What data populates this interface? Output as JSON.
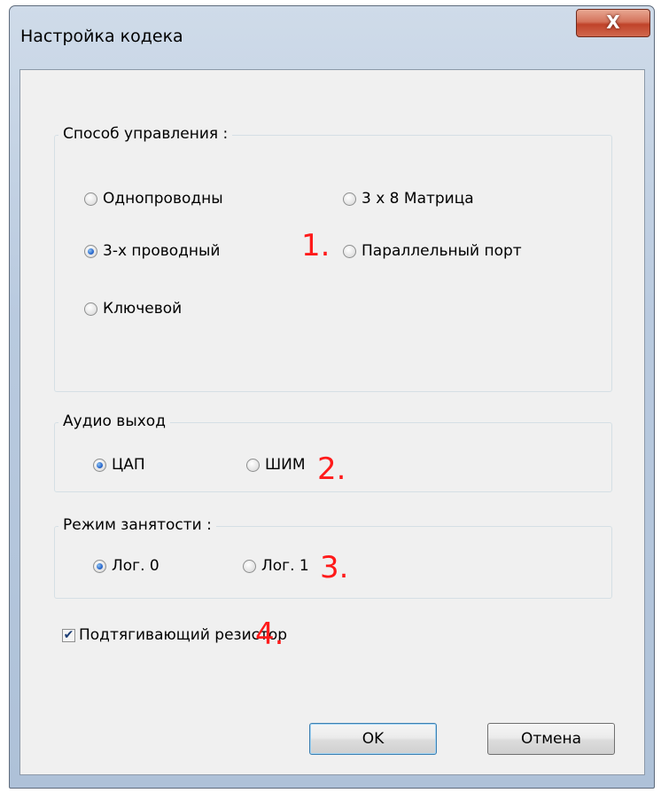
{
  "window": {
    "title": "Настройка кодека",
    "close_glyph": "X"
  },
  "control_group": {
    "legend": "Способ управления :",
    "options": [
      {
        "label": "Однопроводны",
        "selected": false
      },
      {
        "label": "3-х проводный",
        "selected": true
      },
      {
        "label": "Ключевой",
        "selected": false
      },
      {
        "label": "3 x 8 Матрица",
        "selected": false
      },
      {
        "label": "Параллельный порт",
        "selected": false
      }
    ]
  },
  "audio_group": {
    "legend": "Аудио выход",
    "options": [
      {
        "label": "ЦАП",
        "selected": true
      },
      {
        "label": "ШИМ",
        "selected": false
      }
    ]
  },
  "busy_group": {
    "legend": "Режим занятости :",
    "options": [
      {
        "label": "Лог. 0",
        "selected": true
      },
      {
        "label": "Лог. 1",
        "selected": false
      }
    ]
  },
  "pullup_checkbox": {
    "label": "Подтягивающий резистор",
    "checked": true
  },
  "annotations": [
    "1.",
    "2.",
    "3.",
    "4."
  ],
  "buttons": {
    "ok": "OK",
    "cancel": "Отмена"
  },
  "colors": {
    "annotation": "#ff1a1a",
    "close_button": "#c7452c",
    "dialog_background": "#f0f0f0"
  }
}
